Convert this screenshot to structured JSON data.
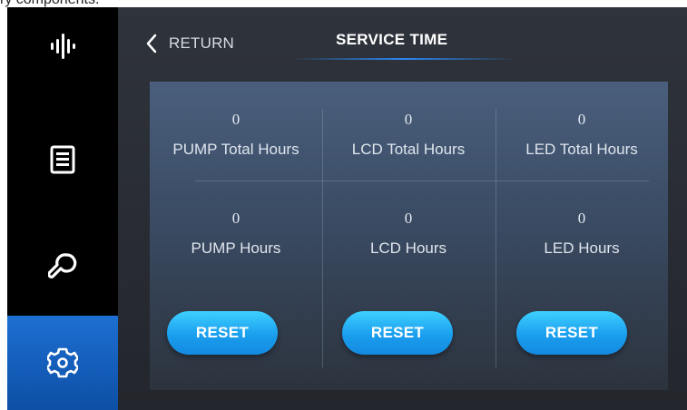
{
  "caption": "ry components.",
  "nav": {
    "items": [
      {
        "icon": "waveform-icon",
        "active": false
      },
      {
        "icon": "document-list-icon",
        "active": false
      },
      {
        "icon": "wrench-icon",
        "active": false
      },
      {
        "icon": "gear-icon",
        "active": true
      }
    ]
  },
  "header": {
    "return_label": "RETURN",
    "title": "SERVICE TIME"
  },
  "service": {
    "columns": [
      {
        "total_value": "0",
        "total_label": "PUMP Total Hours",
        "hours_value": "0",
        "hours_label": "PUMP Hours",
        "reset_label": "RESET"
      },
      {
        "total_value": "0",
        "total_label": "LCD Total Hours",
        "hours_value": "0",
        "hours_label": "LCD Hours",
        "reset_label": "RESET"
      },
      {
        "total_value": "0",
        "total_label": "LED Total Hours",
        "hours_value": "0",
        "hours_label": "LED Hours",
        "reset_label": "RESET"
      }
    ]
  },
  "colors": {
    "accent": "#1a9eee",
    "sidebar_active": "#1466c8",
    "sidebar_bg": "#000000",
    "background": "#26292f"
  }
}
